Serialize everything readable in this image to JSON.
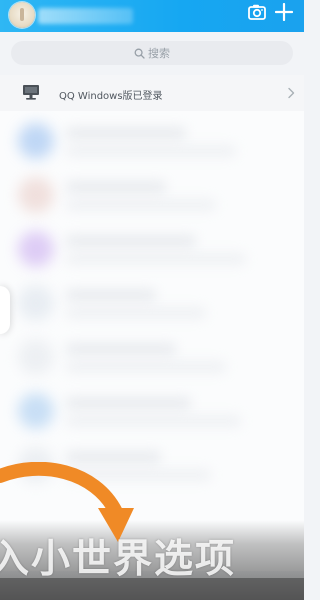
{
  "header": {
    "camera_icon": "camera-icon",
    "add_icon": "plus-icon",
    "accent": "#18a8f2"
  },
  "search": {
    "placeholder": "搜索",
    "icon": "search-icon"
  },
  "device_status": {
    "icon": "monitor-icon",
    "text": "QQ Windows版已登录",
    "chevron": "chevron-right-icon"
  },
  "overlay": {
    "caption": "入小世界选项",
    "arrow_color": "#f08a26"
  }
}
